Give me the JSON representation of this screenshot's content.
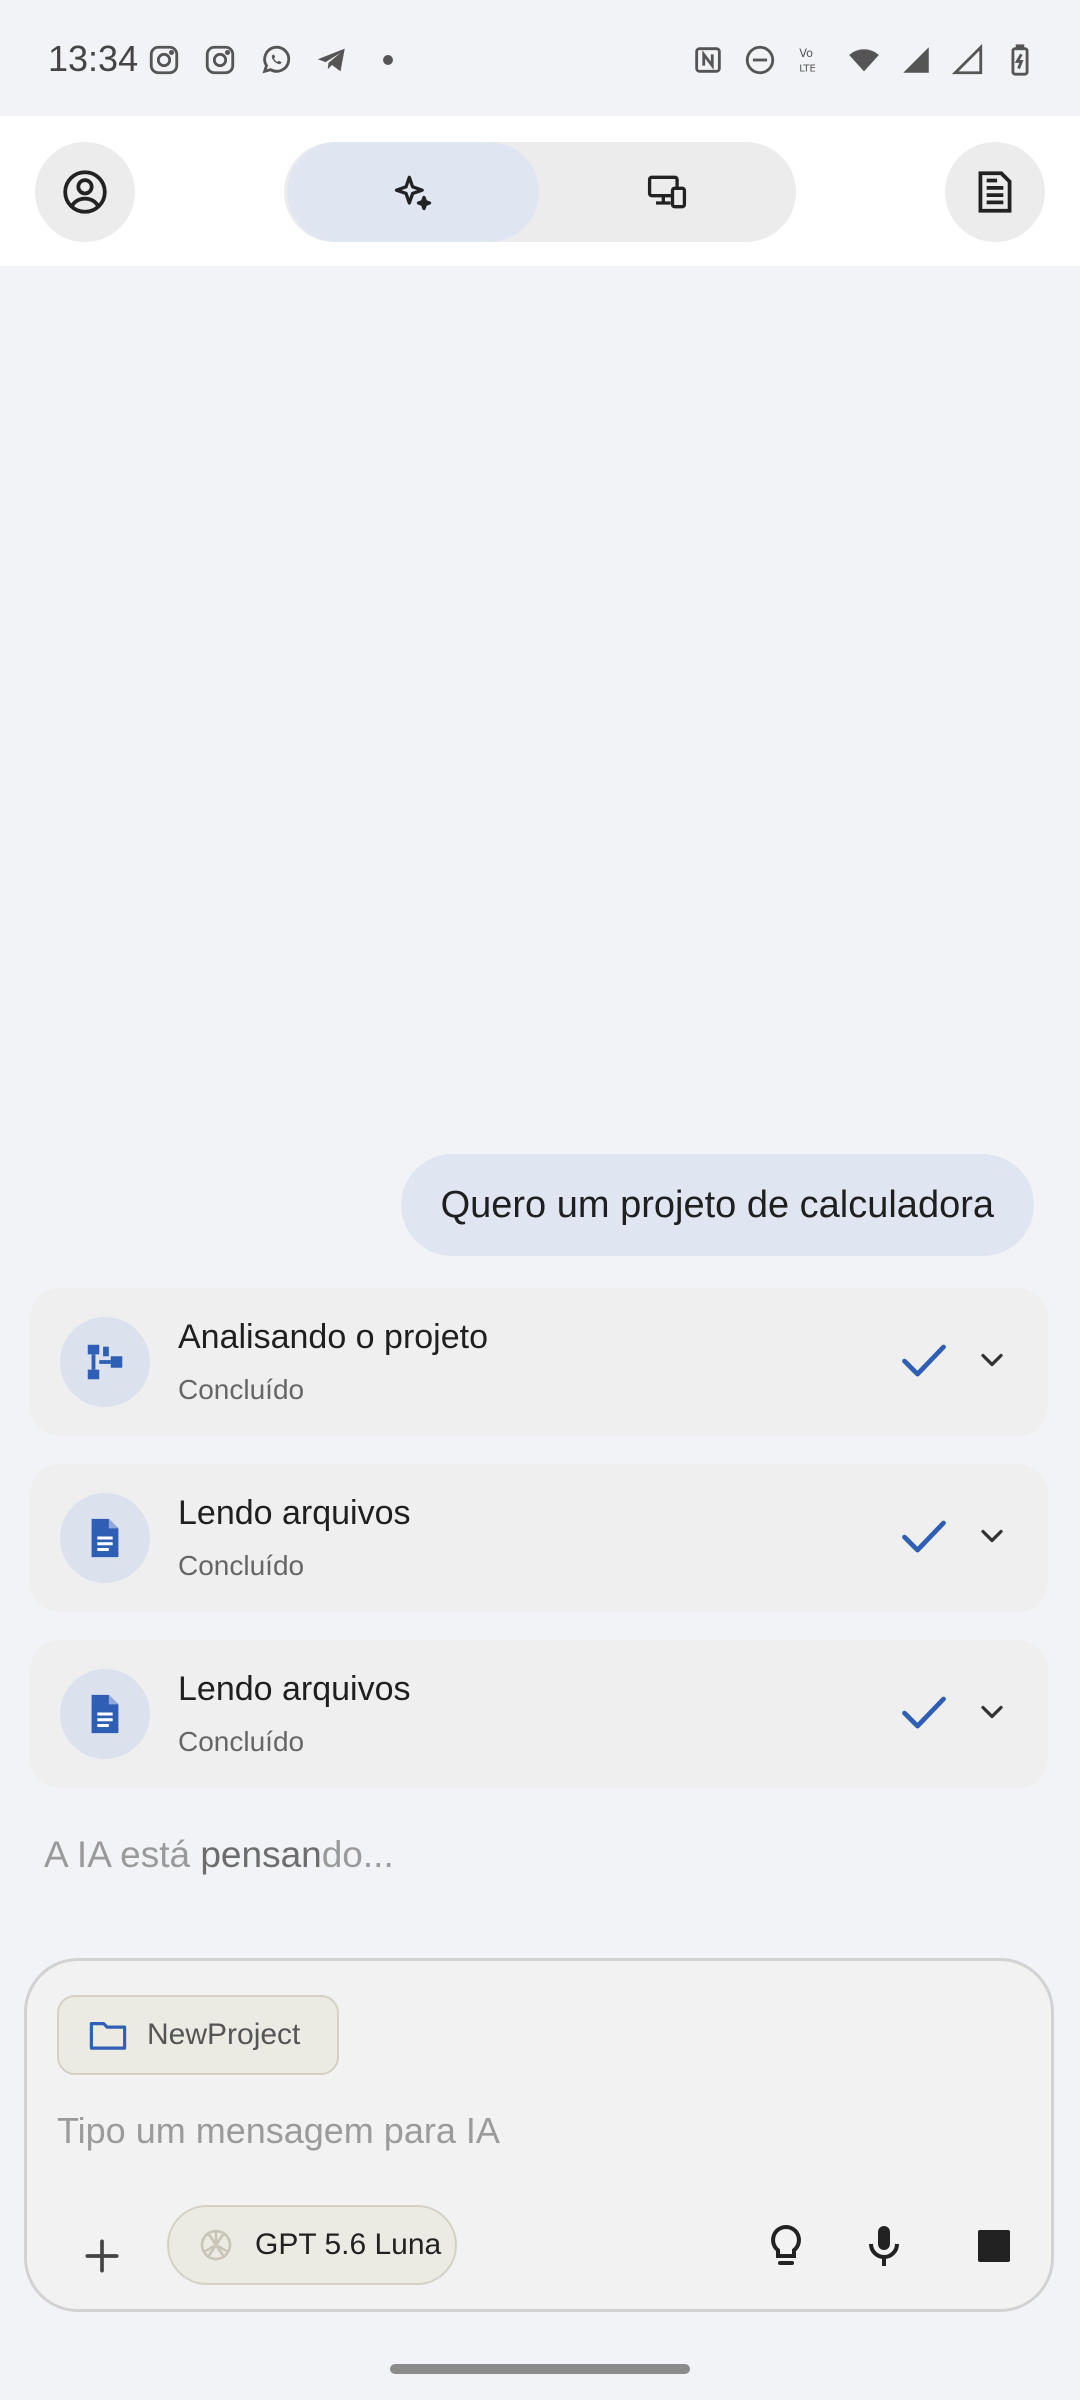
{
  "status_bar": {
    "time": "13:34",
    "left_icons": [
      "instagram-icon",
      "instagram-icon",
      "whatsapp-icon",
      "telegram-icon",
      "dot-icon"
    ],
    "right_icons": [
      "nfc-icon",
      "dnd-icon",
      "volte-icon",
      "wifi-icon",
      "signal-icon",
      "signal-icon",
      "battery-charging-icon"
    ]
  },
  "top_bar": {
    "profile_icon": "account-circle-icon",
    "tabs": [
      {
        "icon": "sparkle-icon",
        "active": true
      },
      {
        "icon": "devices-icon",
        "active": false
      }
    ],
    "doc_icon": "document-icon"
  },
  "chat": {
    "user_message": "Quero um projeto de calculadora",
    "steps": [
      {
        "title": "Analisando o projeto",
        "status": "Concluído",
        "icon": "project-structure-icon"
      },
      {
        "title": "Lendo arquivos",
        "status": "Concluído",
        "icon": "file-icon"
      },
      {
        "title": "Lendo arquivos",
        "status": "Concluído",
        "icon": "file-icon"
      }
    ],
    "thinking_pre": "A IA está ",
    "thinking_hl": "pensan",
    "thinking_post": "do..."
  },
  "composer": {
    "folder_label": "NewProject",
    "placeholder": "Tipo um mensagem para IA",
    "model_label": "GPT 5.6 Luna"
  },
  "colors": {
    "accent": "#2f5fb5",
    "background": "#f2f3f7",
    "bubble": "#dfe6f2"
  }
}
